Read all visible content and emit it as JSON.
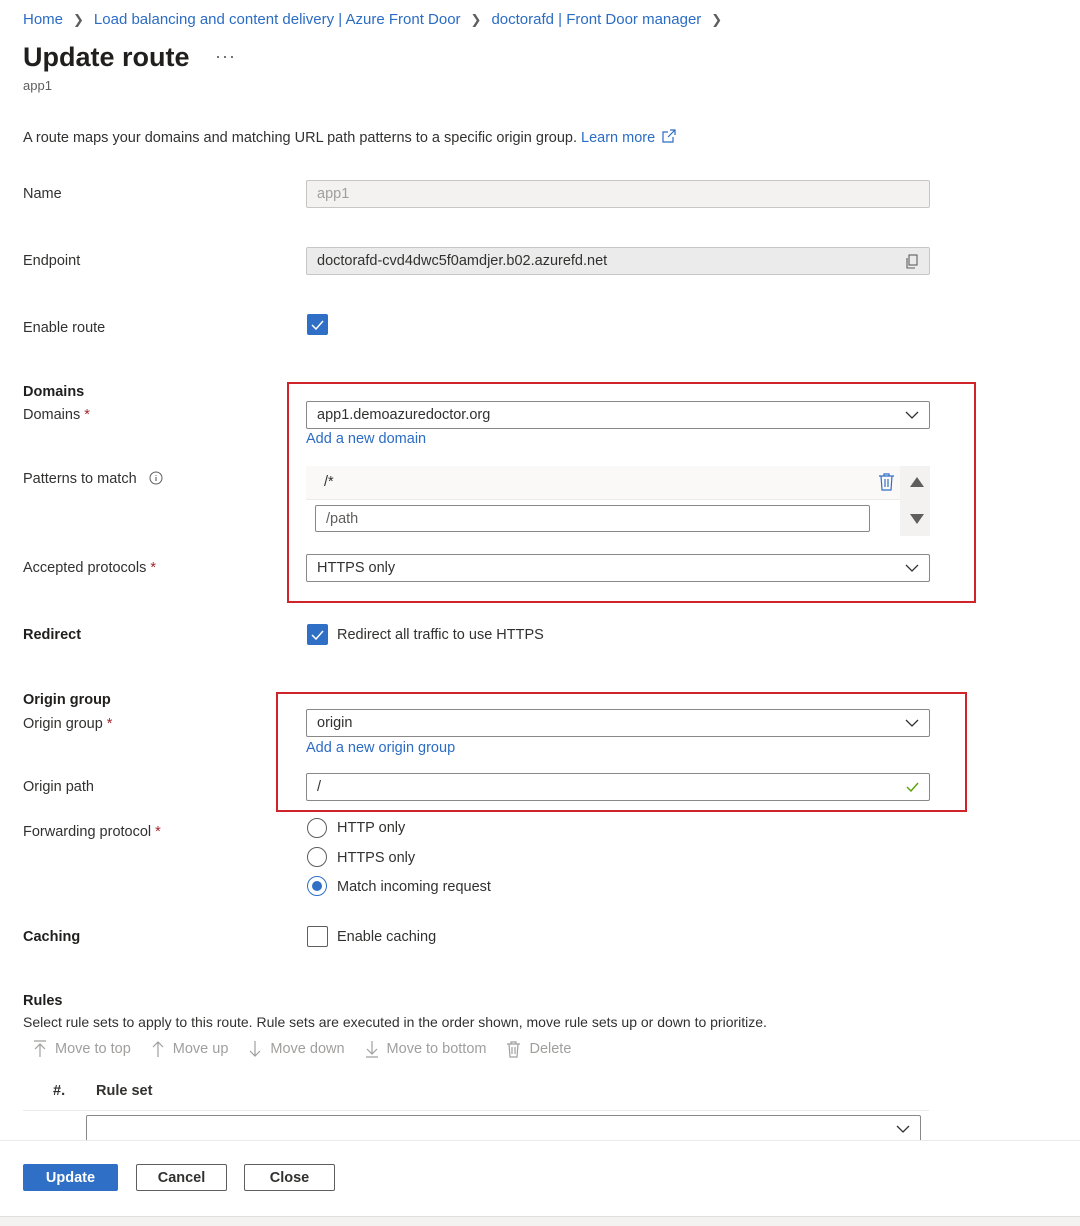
{
  "breadcrumb": {
    "items": [
      "Home",
      "Load balancing and content delivery | Azure Front Door",
      "doctorafd | Front Door manager"
    ]
  },
  "page": {
    "title": "Update route",
    "subtitle": "app1",
    "more_label": "···"
  },
  "description": {
    "text": "A route maps your domains and matching URL path patterns to a specific origin group.",
    "learn_more": "Learn more"
  },
  "form": {
    "name": {
      "label": "Name",
      "value": "app1"
    },
    "endpoint": {
      "label": "Endpoint",
      "value": "doctorafd-cvd4dwc5f0amdjer.b02.azurefd.net"
    },
    "enable_route": {
      "label": "Enable route",
      "checked": true
    },
    "domains_section": "Domains",
    "domains": {
      "label": "Domains",
      "value": "app1.demoazuredoctor.org",
      "add_link": "Add a new domain"
    },
    "patterns": {
      "label": "Patterns to match",
      "items": [
        "/*"
      ],
      "placeholder": "/path"
    },
    "protocols": {
      "label": "Accepted protocols",
      "value": "HTTPS only"
    },
    "redirect": {
      "label": "Redirect",
      "checkbox_label": "Redirect all traffic to use HTTPS",
      "checked": true
    },
    "origin_section": "Origin group",
    "origin_group": {
      "label": "Origin group",
      "value": "origin",
      "add_link": "Add a new origin group"
    },
    "origin_path": {
      "label": "Origin path",
      "value": "/"
    },
    "forwarding": {
      "label": "Forwarding protocol",
      "options": [
        "HTTP only",
        "HTTPS only",
        "Match incoming request"
      ],
      "selected": "Match incoming request"
    },
    "caching": {
      "label": "Caching",
      "checkbox_label": "Enable caching",
      "checked": false
    },
    "required_mark": "*"
  },
  "rules": {
    "heading": "Rules",
    "description": "Select rule sets to apply to this route. Rule sets are executed in the order shown, move rule sets up or down to prioritize.",
    "toolbar": [
      "Move to top",
      "Move up",
      "Move down",
      "Move to bottom",
      "Delete"
    ],
    "columns": [
      "#.",
      "Rule set"
    ],
    "ruleset_value": ""
  },
  "footer": {
    "update": "Update",
    "cancel": "Cancel",
    "close": "Close"
  },
  "colors": {
    "accent": "#2f6fc6",
    "link": "#2b6cc4",
    "highlight_border": "#d1232a",
    "success": "#57a300"
  }
}
